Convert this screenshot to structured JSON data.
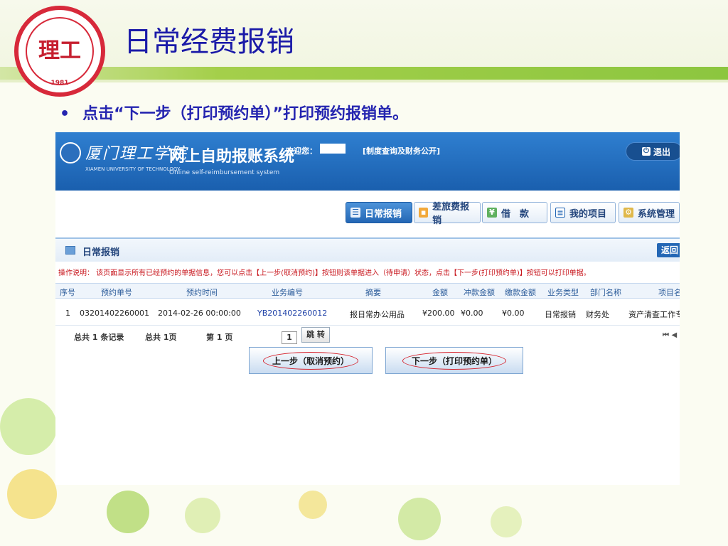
{
  "slide": {
    "title": "日常经费报销",
    "bullet": "点击“下一步（打印预约单）”打印预约报销单。",
    "logo_text": "理工",
    "logo_year": "1981"
  },
  "app": {
    "school_name": "厦门理工学院",
    "school_name_en": "XIAMEN UNIVERSITY OF TECHNOLOGY",
    "system_name": "网上自助报账系统",
    "system_name_en": "Online self-reimbursement system",
    "welcome": "欢迎您：",
    "header_link": "[制度查询及财务公开]",
    "logout": "退出"
  },
  "nav": {
    "items": [
      {
        "label": "日常报销",
        "icon": "list-icon"
      },
      {
        "label": "差旅费报销",
        "icon": "truck-icon"
      },
      {
        "label": "借　款",
        "icon": "loan-icon"
      },
      {
        "label": "我的项目",
        "icon": "document-icon"
      },
      {
        "label": "系统管理",
        "icon": "settings-icon"
      }
    ]
  },
  "panel": {
    "title": "日常报销",
    "back": "返回",
    "instructions": "操作说明：  该页面显示所有已经预约的单据信息，您可以点击【上一步(取消预约)】按钮则该单据进入（待申请）状态，点击【下一步(打印预约单)】按钮可以打印单据。"
  },
  "table": {
    "headers": [
      "序号",
      "预约单号",
      "预约时间",
      "业务编号",
      "摘要",
      "金额",
      "冲款金额",
      "缴款金额",
      "业务类型",
      "部门名称",
      "项目名"
    ],
    "rows": [
      [
        "1",
        "03201402260001",
        "2014-02-26 00:00:00",
        "YB201402260012",
        "报日常办公用品",
        "¥200.00",
        "¥0.00",
        "¥0.00",
        "日常报销",
        "财务处",
        "资产清查工作专"
      ]
    ]
  },
  "pager": {
    "total_label": "总共 1  条记录",
    "pages_label": "总共  1页",
    "current_label": "第 1 页",
    "page_value": "1",
    "jump": "跳 转",
    "nav": "⏮ ◀"
  },
  "actions": {
    "prev": "上一步（取消预约）",
    "next": "下一步（打印预约单）"
  }
}
